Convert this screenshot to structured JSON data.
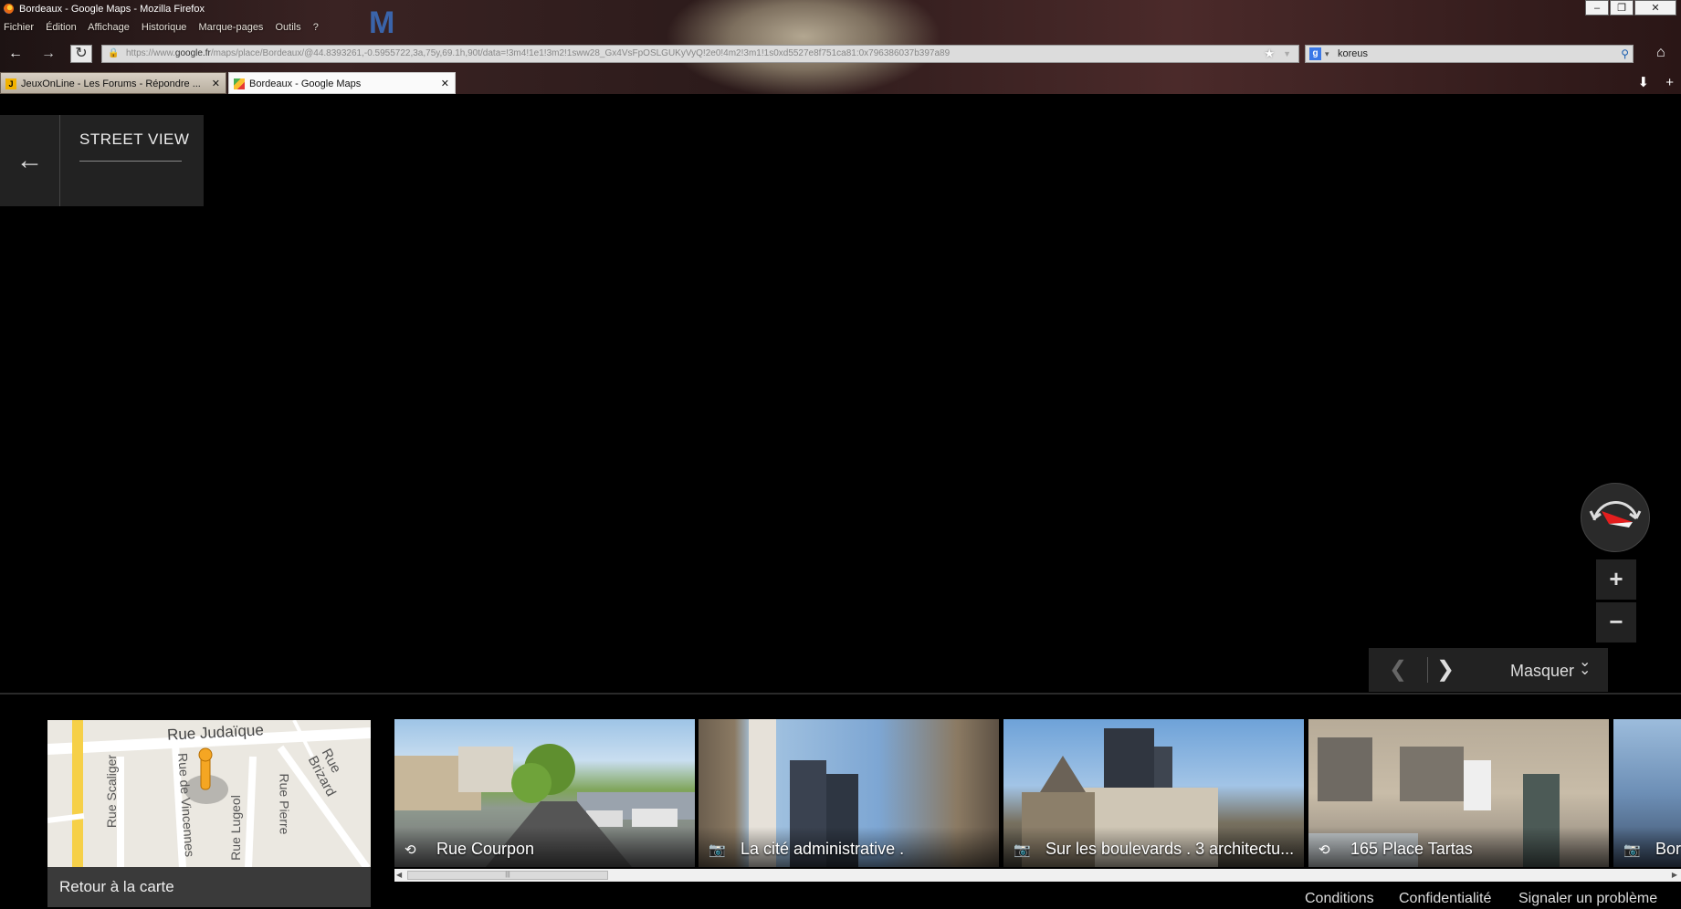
{
  "window": {
    "title": "Bordeaux - Google Maps - Mozilla Firefox",
    "controls": [
      "‒",
      "❐",
      "✕"
    ]
  },
  "menu": [
    "Fichier",
    "Édition",
    "Affichage",
    "Historique",
    "Marque-pages",
    "Outils",
    "?"
  ],
  "nav": {
    "back_icon": "←",
    "forward_icon": "→",
    "reload_icon": "↻",
    "url_prefix": "https://www.",
    "url_domain": "google.fr",
    "url_rest": "/maps/place/Bordeaux/@44.8393261,-0.5955722,3a,75y,69.1h,90t/data=!3m4!1e1!3m2!1sww28_Gx4VsFpOSLGUKyVyQ!2e0!4m2!3m1!1s0xd5527e8f751ca81:0x796386037b397a89",
    "search_engine": "g",
    "search_query": "koreus",
    "home_icon": "⌂"
  },
  "tabs": [
    {
      "label": "JeuxOnLine - Les Forums - Répondre ...",
      "close": "✕"
    },
    {
      "label": "Bordeaux - Google Maps",
      "close": "✕"
    }
  ],
  "tab_tools": {
    "download": "⬇",
    "new_tab": "+"
  },
  "streetview": {
    "back_icon": "←",
    "title": "STREET VIEW",
    "zoom_in": "+",
    "zoom_out": "−",
    "prev": "❮",
    "next": "❯",
    "hide_label": "Masquer",
    "collapse_icon": "⌄⌄"
  },
  "minimap": {
    "streets": [
      "Rue Judaïque",
      "Rue Scaliger",
      "Rue de Vincennes",
      "Rue Lugeol",
      "Rue Pierre",
      "Rue Brizard"
    ],
    "return_label": "Retour à la carte"
  },
  "thumbnails": [
    {
      "type": "streetview",
      "label": "Rue Courpon"
    },
    {
      "type": "photo",
      "label": "La cité administrative ."
    },
    {
      "type": "photo",
      "label": "Sur les boulevards . 3 architectu..."
    },
    {
      "type": "streetview",
      "label": "165 Place Tartas"
    },
    {
      "type": "photo",
      "label": "Bor"
    }
  ],
  "footer": {
    "conditions": "Conditions",
    "privacy": "Confidentialité",
    "report": "Signaler un problème"
  }
}
